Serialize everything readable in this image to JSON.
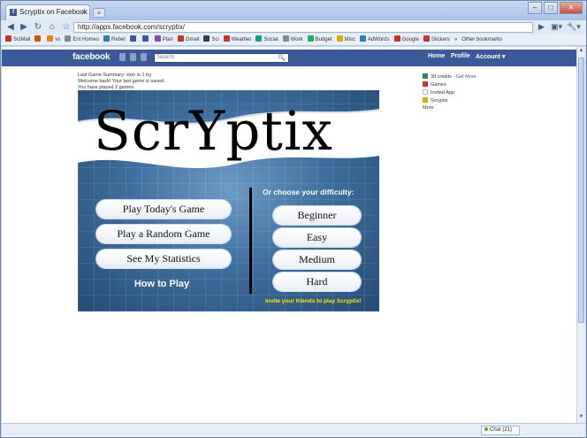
{
  "browser": {
    "tab_title": "Scryptix on Facebook",
    "tab_close": "×",
    "new_tab": "+",
    "url": "http://apps.facebook.com/scryptix/",
    "window_buttons": [
      "–",
      "□",
      "✕"
    ],
    "back": "◀",
    "forward": "▶",
    "reload": "↻",
    "home": "⌂",
    "star": "☆",
    "page_menu": "▣▾",
    "tools_menu": "🔧▾",
    "go": "▶",
    "bookmarks": [
      {
        "label": "SciMail",
        "color": "#c0392b"
      },
      {
        "label": "",
        "color": "#d35400"
      },
      {
        "label": "vs",
        "color": "#e67e22"
      },
      {
        "label": "Ent Homes",
        "color": "#7f8c8d"
      },
      {
        "label": "Rebel",
        "color": "#2980b9"
      },
      {
        "label": "",
        "color": "#3b5998"
      },
      {
        "label": "",
        "color": "#3b5998"
      },
      {
        "label": "Plan",
        "color": "#8e44ad"
      },
      {
        "label": "Gmail",
        "color": "#c0392b"
      },
      {
        "label": "Sci",
        "color": "#2c3e50"
      },
      {
        "label": "Weather",
        "color": "#c0392b"
      },
      {
        "label": "Social",
        "color": "#16a085"
      },
      {
        "label": "Work",
        "color": "#7f8c8d"
      },
      {
        "label": "Budget",
        "color": "#27ae60"
      },
      {
        "label": "Misc",
        "color": "#d4ac0d"
      },
      {
        "label": "AdWords",
        "color": "#2980b9"
      },
      {
        "label": "Google",
        "color": "#c0392b"
      },
      {
        "label": "Slickers",
        "color": "#c0392b"
      }
    ],
    "bookmarks_more": "»",
    "other_bookmarks": "Other bookmarks"
  },
  "facebook": {
    "logo": "facebook",
    "search_placeholder": "Search",
    "search_icon": "🔍",
    "nav": [
      "Home",
      "Profile",
      "Account ▾"
    ]
  },
  "notes": [
    "Last Game Summary: won in 1 try.",
    "Welcome back! Your last game is saved.",
    "You have played 2 games."
  ],
  "game": {
    "logo": "ScrYptix",
    "left_buttons": [
      "Play Today's Game",
      "Play a Random Game",
      "See My Statistics"
    ],
    "how_to_play": "How to Play",
    "choose_label": "Or choose your difficulty:",
    "difficulties": [
      "Beginner",
      "Easy",
      "Medium",
      "Hard"
    ],
    "invite": "Invite your friends to play Scryptix!"
  },
  "sidebar": [
    {
      "label": "30 credits",
      "link": "Get More",
      "color": "#2e8b57"
    },
    {
      "label": "Games",
      "link": "",
      "color": "#c0392b"
    },
    {
      "label": "Invited App",
      "link": "",
      "color": "#ffffff"
    },
    {
      "label": "Scryptix",
      "link": "",
      "color": "#d4ac0d"
    },
    {
      "label": "More",
      "link": "",
      "color": ""
    }
  ],
  "statusbar": {
    "chat": "Chat (21)"
  }
}
